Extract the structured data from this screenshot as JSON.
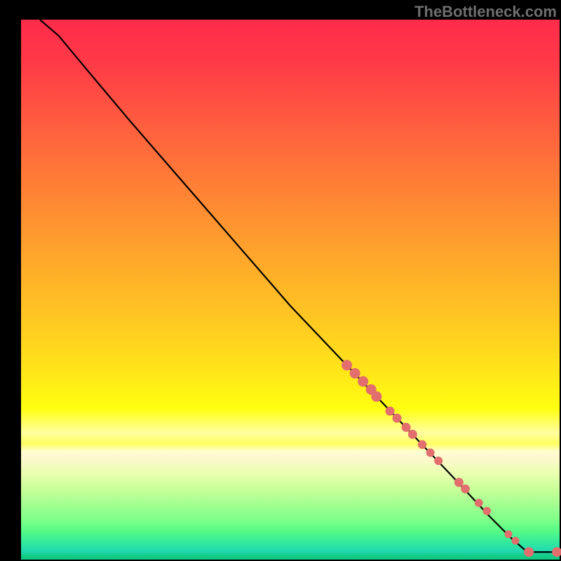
{
  "watermark": "TheBottleneck.com",
  "chart_data": {
    "type": "line",
    "title": "",
    "xlabel": "",
    "ylabel": "",
    "xlim": [
      0,
      100
    ],
    "ylim": [
      0,
      100
    ],
    "series": [
      {
        "name": "curve",
        "type": "line",
        "points": [
          {
            "x": 3.5,
            "y": 100
          },
          {
            "x": 7,
            "y": 97
          },
          {
            "x": 12,
            "y": 91
          },
          {
            "x": 20,
            "y": 81.5
          },
          {
            "x": 30,
            "y": 70
          },
          {
            "x": 40,
            "y": 58.5
          },
          {
            "x": 50,
            "y": 47
          },
          {
            "x": 60,
            "y": 36.5
          },
          {
            "x": 70,
            "y": 26
          },
          {
            "x": 80,
            "y": 15.5
          },
          {
            "x": 87,
            "y": 8
          },
          {
            "x": 91,
            "y": 4
          },
          {
            "x": 94,
            "y": 1.4
          },
          {
            "x": 97,
            "y": 1.4
          },
          {
            "x": 99.5,
            "y": 1.4
          }
        ]
      },
      {
        "name": "markers",
        "type": "scatter",
        "points": [
          {
            "x": 60.5,
            "y": 36,
            "r": 7.5
          },
          {
            "x": 62,
            "y": 34.5,
            "r": 7.5
          },
          {
            "x": 63.5,
            "y": 33,
            "r": 7.5
          },
          {
            "x": 65,
            "y": 31.5,
            "r": 7.5
          },
          {
            "x": 66,
            "y": 30.2,
            "r": 7.5
          },
          {
            "x": 68.5,
            "y": 27.5,
            "r": 6.5
          },
          {
            "x": 69.8,
            "y": 26.2,
            "r": 6.5
          },
          {
            "x": 71.5,
            "y": 24.5,
            "r": 6.5
          },
          {
            "x": 72.7,
            "y": 23.2,
            "r": 6.5
          },
          {
            "x": 74.5,
            "y": 21.3,
            "r": 6.2
          },
          {
            "x": 76,
            "y": 19.8,
            "r": 6.0
          },
          {
            "x": 77.5,
            "y": 18.3,
            "r": 6.0
          },
          {
            "x": 81.3,
            "y": 14.3,
            "r": 6.5
          },
          {
            "x": 82.5,
            "y": 13.1,
            "r": 6.3
          },
          {
            "x": 85,
            "y": 10.5,
            "r": 5.8
          },
          {
            "x": 86.5,
            "y": 9.0,
            "r": 5.8
          },
          {
            "x": 90.5,
            "y": 4.7,
            "r": 5.5
          },
          {
            "x": 91.8,
            "y": 3.5,
            "r": 5.5
          },
          {
            "x": 94.3,
            "y": 1.4,
            "r": 7.0
          },
          {
            "x": 99.5,
            "y": 1.4,
            "r": 7.0
          }
        ]
      }
    ]
  }
}
